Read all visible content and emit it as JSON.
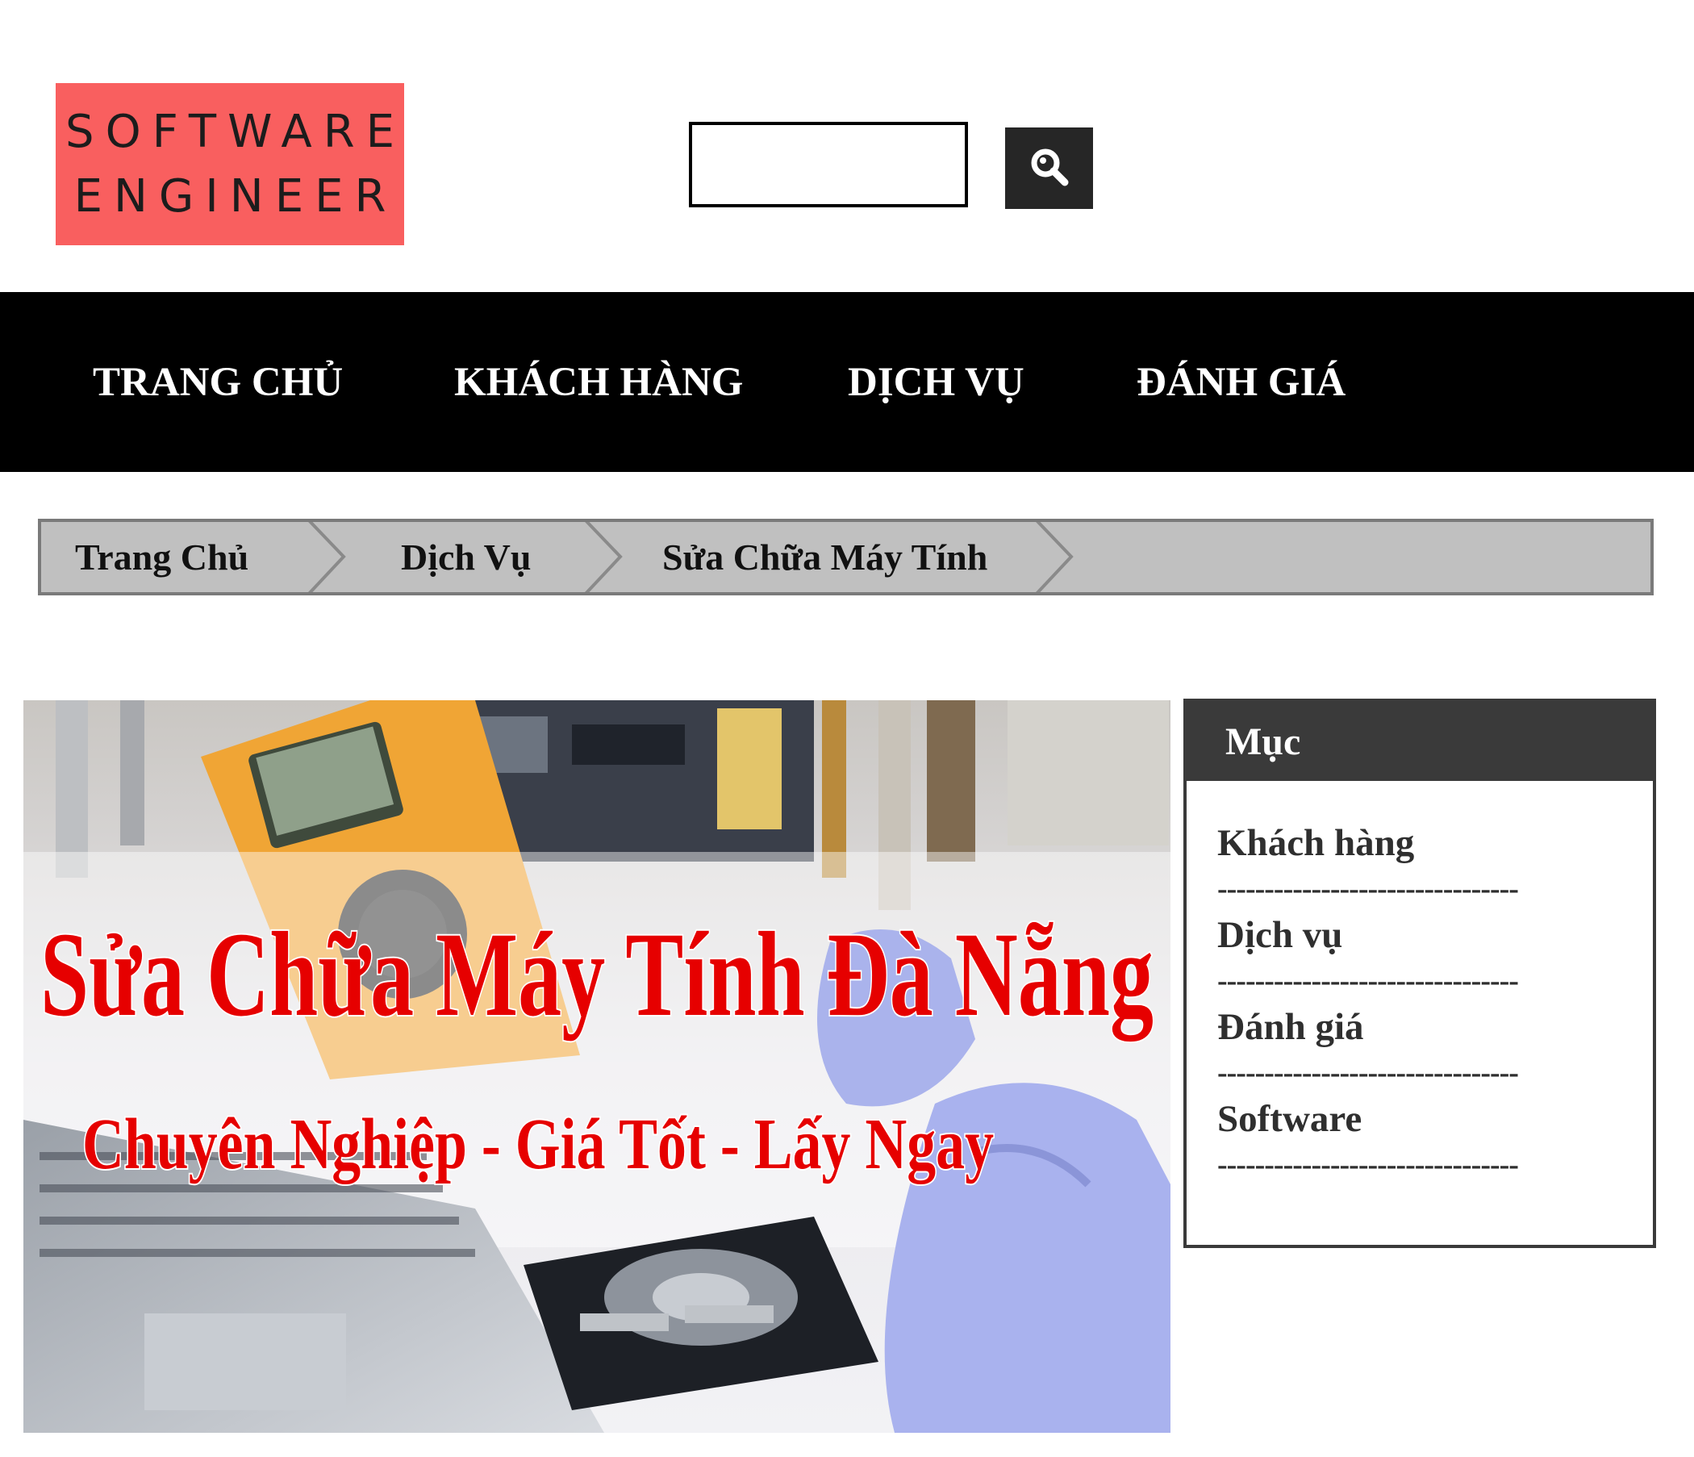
{
  "header": {
    "logo_line1": "SOFTWARE",
    "logo_line2": "ENGINEER",
    "search": {
      "value": "",
      "placeholder": ""
    },
    "search_icon": "search-icon"
  },
  "nav": {
    "items": [
      {
        "label": "TRANG CHỦ"
      },
      {
        "label": "KHÁCH HÀNG"
      },
      {
        "label": "DỊCH VỤ"
      },
      {
        "label": "ĐÁNH GIÁ"
      }
    ]
  },
  "breadcrumb": {
    "items": [
      {
        "label": "Trang Chủ"
      },
      {
        "label": "Dịch Vụ"
      },
      {
        "label": "Sửa Chữa Máy Tính"
      }
    ]
  },
  "banner": {
    "title": "Sửa Chữa Máy Tính Đà Nẵng",
    "subtitle": "Chuyên Nghiệp - Giá Tốt - Lấy Ngay"
  },
  "sidebar": {
    "title": "Mục",
    "items": [
      {
        "label": "Khách hàng"
      },
      {
        "label": "Dịch vụ"
      },
      {
        "label": "Đánh giá"
      },
      {
        "label": "Software"
      }
    ],
    "separator": "--------------------------------"
  },
  "colors": {
    "logo_bg": "#f95f5f",
    "nav_bg": "#000000",
    "breadcrumb_bg": "#c0c0c0",
    "sidebar_head_bg": "#3a3a3a",
    "banner_text": "#e60000"
  }
}
